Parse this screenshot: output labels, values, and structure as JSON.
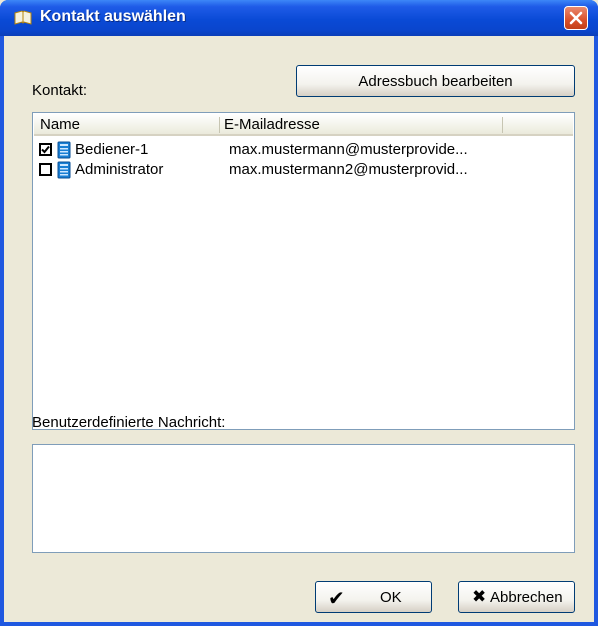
{
  "window": {
    "title": "Kontakt auswählen",
    "close_symbol": "✕"
  },
  "contact": {
    "label": "Kontakt:",
    "edit_addressbook_button": "Adressbuch bearbeiten"
  },
  "list": {
    "columns": [
      "Name",
      "E-Mailadresse"
    ],
    "rows": [
      {
        "checked": true,
        "name": "Bediener-1",
        "email": "max.mustermann@musterprovide..."
      },
      {
        "checked": false,
        "name": "Administrator",
        "email": "max.mustermann2@musterprovid..."
      }
    ]
  },
  "message": {
    "label": "Benutzerdefinierte Nachricht:",
    "value": ""
  },
  "footer": {
    "ok_label": "OK",
    "ok_icon": "✔",
    "cancel_label": "Abbrechen",
    "cancel_icon": "✖"
  },
  "icons": {
    "title": "address-book-icon",
    "row": "contact-card-icon"
  },
  "colors": {
    "titlebar": "#0a4ad6",
    "dialog_bg": "#ece9d8",
    "list_border": "#7f9db9",
    "button_border": "#003c74",
    "row_icon": "#1a7fd4"
  }
}
